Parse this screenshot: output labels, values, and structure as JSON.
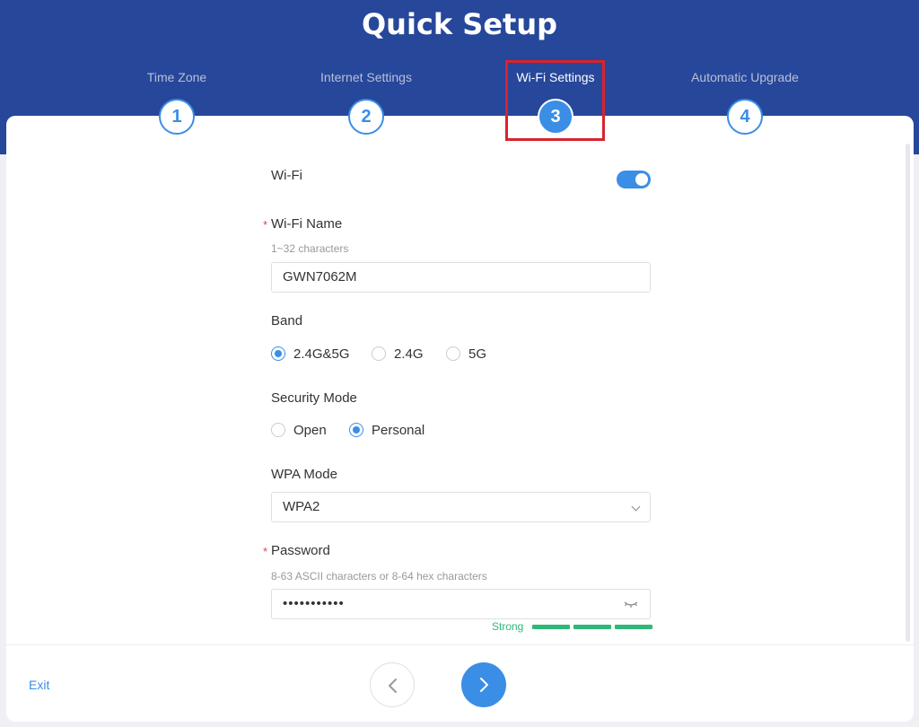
{
  "header": {
    "title": "Quick Setup"
  },
  "steps": [
    {
      "number": "1",
      "label": "Time Zone"
    },
    {
      "number": "2",
      "label": "Internet Settings"
    },
    {
      "number": "3",
      "label": "Wi-Fi Settings"
    },
    {
      "number": "4",
      "label": "Automatic Upgrade"
    }
  ],
  "active_step": 3,
  "form": {
    "wifi": {
      "label": "Wi-Fi",
      "enabled": true
    },
    "wifi_name": {
      "required_mark": "*",
      "label": "Wi-Fi Name",
      "hint": "1~32 characters",
      "value": "GWN7062M"
    },
    "band": {
      "label": "Band",
      "options": [
        "2.4G&5G",
        "2.4G",
        "5G"
      ],
      "selected": "2.4G&5G"
    },
    "security_mode": {
      "label": "Security Mode",
      "options": [
        "Open",
        "Personal"
      ],
      "selected": "Personal"
    },
    "wpa_mode": {
      "label": "WPA Mode",
      "value": "WPA2"
    },
    "password": {
      "required_mark": "*",
      "label": "Password",
      "hint": "8-63 ASCII characters or 8-64 hex characters",
      "value": "•••••••••••",
      "strength": "Strong"
    }
  },
  "footer": {
    "exit_label": "Exit"
  },
  "colors": {
    "header_bg": "#26479a",
    "accent": "#3a8ee6",
    "strength": "#2fb879",
    "highlight": "#d9232e"
  }
}
